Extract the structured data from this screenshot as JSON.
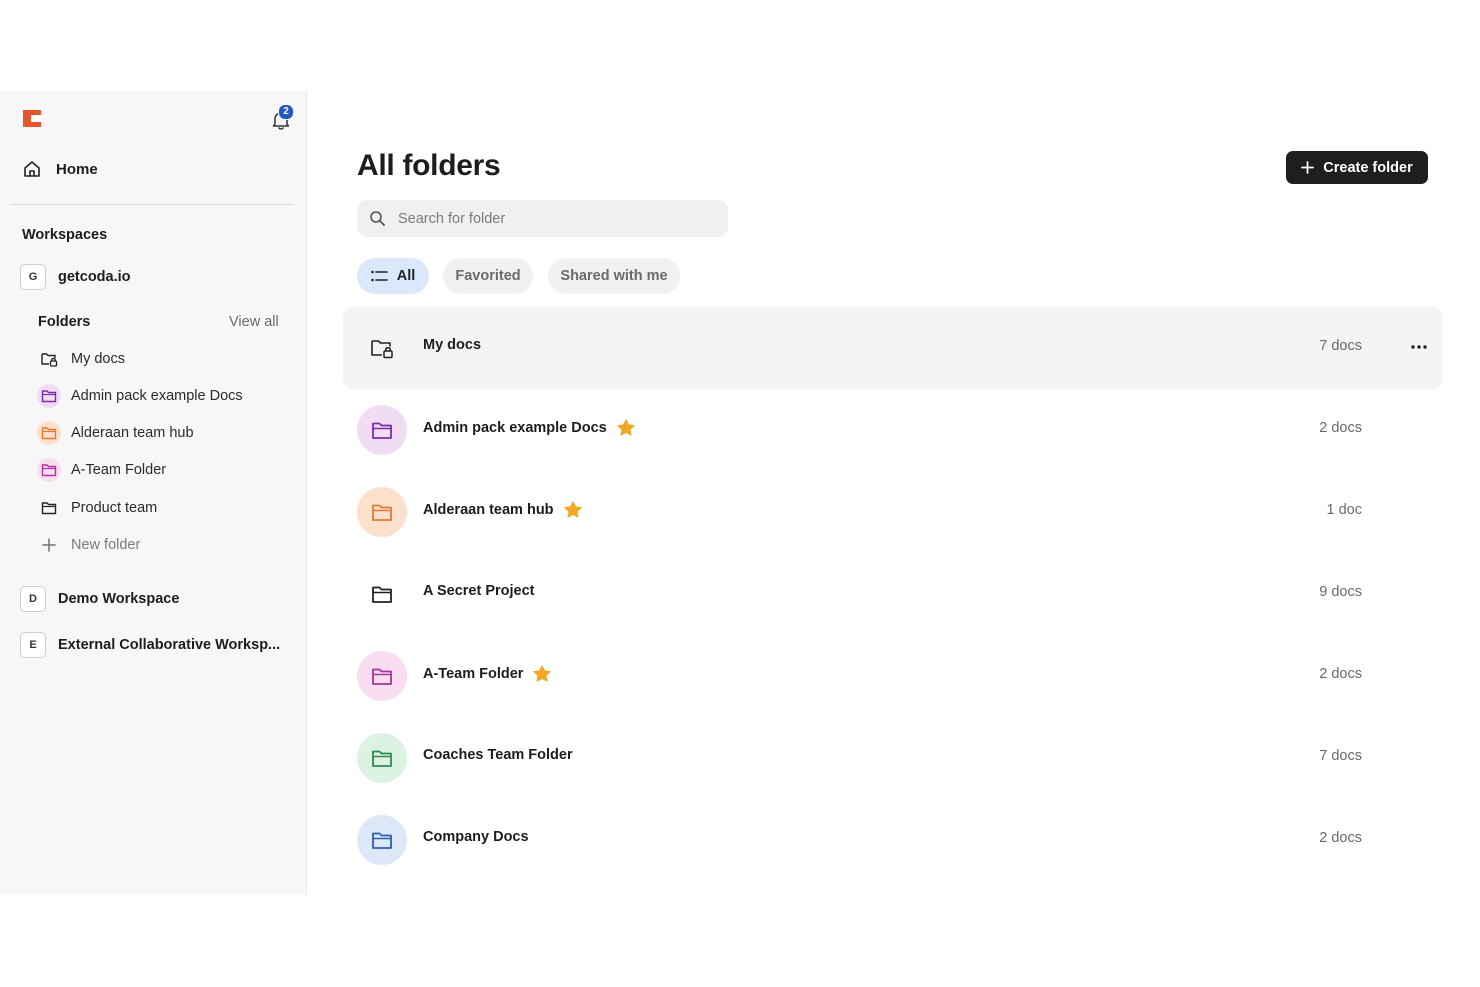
{
  "colors": {
    "brand": "#e8552d",
    "accent_blue": "#1f58c7",
    "purple": "#7e2ca8",
    "orange": "#e07a37",
    "pink": "#a8339a",
    "green": "#2f8a4d",
    "blue": "#2c5fb0",
    "star": "#f5a623"
  },
  "sidebar": {
    "logo_icon": "coda-logo",
    "notification_count": "2",
    "home_label": "Home",
    "workspaces_heading": "Workspaces",
    "workspaces": [
      {
        "badge": "G",
        "label": "getcoda.io"
      },
      {
        "badge": "D",
        "label": "Demo Workspace"
      },
      {
        "badge": "E",
        "label": "External Collaborative Worksp..."
      }
    ],
    "folders_heading": "Folders",
    "view_all_label": "View all",
    "folders": [
      {
        "label": "My docs",
        "icon": "folder-lock-icon"
      },
      {
        "label": "Admin pack example Docs",
        "icon": "folder-icon"
      },
      {
        "label": "Alderaan team hub",
        "icon": "folder-icon"
      },
      {
        "label": "A-Team Folder",
        "icon": "folder-icon"
      },
      {
        "label": "Product team",
        "icon": "folder-icon"
      }
    ],
    "new_folder_label": "New folder"
  },
  "main": {
    "title": "All folders",
    "create_button_label": "Create folder",
    "search_placeholder": "Search for folder",
    "filters": [
      "All",
      "Favorited",
      "Shared with me"
    ],
    "active_filter": "All",
    "folders": [
      {
        "name": "My docs",
        "count": "7 docs",
        "favorited": false
      },
      {
        "name": "Admin pack example Docs",
        "count": "2 docs",
        "favorited": true
      },
      {
        "name": "Alderaan team hub",
        "count": "1 doc",
        "favorited": true
      },
      {
        "name": "A Secret Project",
        "count": "9 docs",
        "favorited": false
      },
      {
        "name": "A-Team Folder",
        "count": "2 docs",
        "favorited": true
      },
      {
        "name": "Coaches Team Folder",
        "count": "7 docs",
        "favorited": false
      },
      {
        "name": "Company Docs",
        "count": "2 docs",
        "favorited": false
      }
    ]
  }
}
